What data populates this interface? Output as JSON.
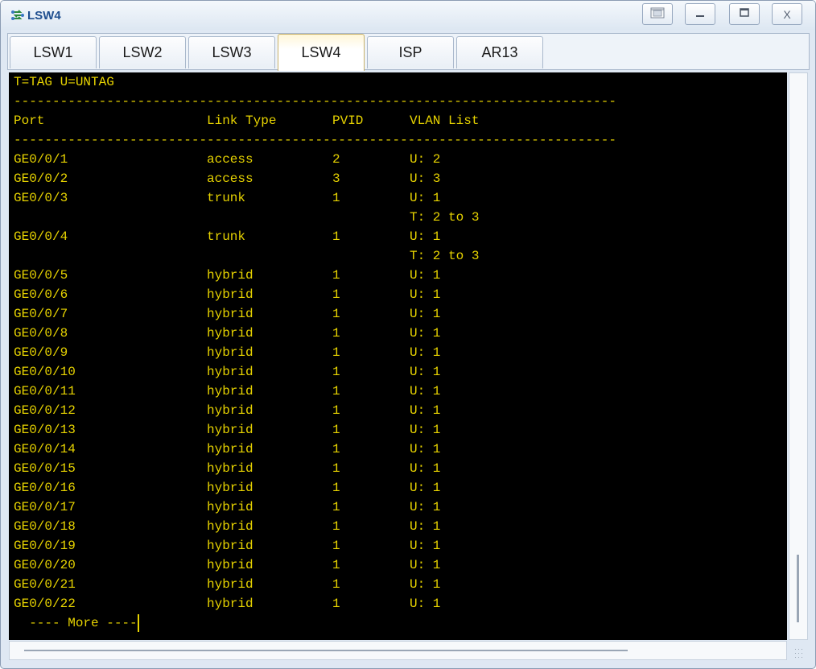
{
  "window": {
    "title": "LSW4",
    "icon": "switch-icon",
    "controls": {
      "restore": "restore-icon",
      "minimize": "—",
      "maximize": "□",
      "close": "X"
    }
  },
  "tabs": [
    {
      "label": "LSW1",
      "active": false
    },
    {
      "label": "LSW2",
      "active": false
    },
    {
      "label": "LSW3",
      "active": false
    },
    {
      "label": "LSW4",
      "active": true
    },
    {
      "label": "ISP",
      "active": false
    },
    {
      "label": "AR13",
      "active": false
    }
  ],
  "terminal": {
    "legend": "T=TAG U=UNTAG",
    "separator": "------------------------------------------------------------------------------",
    "header": {
      "port": "Port",
      "link_type": "Link Type",
      "pvid": "PVID",
      "vlan_list": "VLAN List"
    },
    "rows": [
      {
        "port": "GE0/0/1",
        "link_type": "access",
        "pvid": "2",
        "vlan": "U: 2"
      },
      {
        "port": "GE0/0/2",
        "link_type": "access",
        "pvid": "3",
        "vlan": "U: 3"
      },
      {
        "port": "GE0/0/3",
        "link_type": "trunk",
        "pvid": "1",
        "vlan": "U: 1"
      },
      {
        "port": "",
        "link_type": "",
        "pvid": "",
        "vlan": "T: 2 to 3"
      },
      {
        "port": "GE0/0/4",
        "link_type": "trunk",
        "pvid": "1",
        "vlan": "U: 1"
      },
      {
        "port": "",
        "link_type": "",
        "pvid": "",
        "vlan": "T: 2 to 3"
      },
      {
        "port": "GE0/0/5",
        "link_type": "hybrid",
        "pvid": "1",
        "vlan": "U: 1"
      },
      {
        "port": "GE0/0/6",
        "link_type": "hybrid",
        "pvid": "1",
        "vlan": "U: 1"
      },
      {
        "port": "GE0/0/7",
        "link_type": "hybrid",
        "pvid": "1",
        "vlan": "U: 1"
      },
      {
        "port": "GE0/0/8",
        "link_type": "hybrid",
        "pvid": "1",
        "vlan": "U: 1"
      },
      {
        "port": "GE0/0/9",
        "link_type": "hybrid",
        "pvid": "1",
        "vlan": "U: 1"
      },
      {
        "port": "GE0/0/10",
        "link_type": "hybrid",
        "pvid": "1",
        "vlan": "U: 1"
      },
      {
        "port": "GE0/0/11",
        "link_type": "hybrid",
        "pvid": "1",
        "vlan": "U: 1"
      },
      {
        "port": "GE0/0/12",
        "link_type": "hybrid",
        "pvid": "1",
        "vlan": "U: 1"
      },
      {
        "port": "GE0/0/13",
        "link_type": "hybrid",
        "pvid": "1",
        "vlan": "U: 1"
      },
      {
        "port": "GE0/0/14",
        "link_type": "hybrid",
        "pvid": "1",
        "vlan": "U: 1"
      },
      {
        "port": "GE0/0/15",
        "link_type": "hybrid",
        "pvid": "1",
        "vlan": "U: 1"
      },
      {
        "port": "GE0/0/16",
        "link_type": "hybrid",
        "pvid": "1",
        "vlan": "U: 1"
      },
      {
        "port": "GE0/0/17",
        "link_type": "hybrid",
        "pvid": "1",
        "vlan": "U: 1"
      },
      {
        "port": "GE0/0/18",
        "link_type": "hybrid",
        "pvid": "1",
        "vlan": "U: 1"
      },
      {
        "port": "GE0/0/19",
        "link_type": "hybrid",
        "pvid": "1",
        "vlan": "U: 1"
      },
      {
        "port": "GE0/0/20",
        "link_type": "hybrid",
        "pvid": "1",
        "vlan": "U: 1"
      },
      {
        "port": "GE0/0/21",
        "link_type": "hybrid",
        "pvid": "1",
        "vlan": "U: 1"
      },
      {
        "port": "GE0/0/22",
        "link_type": "hybrid",
        "pvid": "1",
        "vlan": "U: 1"
      }
    ],
    "more_prompt": "  ---- More ----",
    "colors": {
      "text": "#e7d300",
      "background": "#000000"
    }
  }
}
